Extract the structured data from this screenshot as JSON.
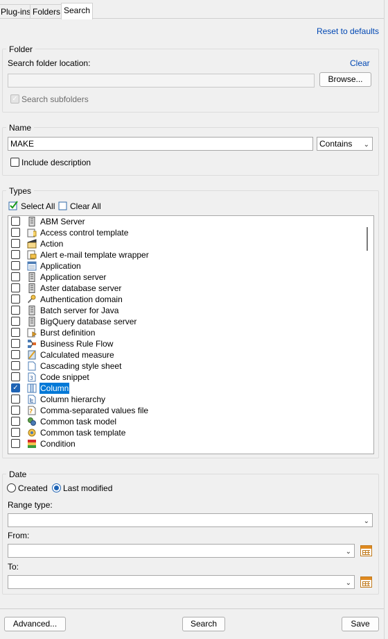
{
  "tabs": [
    {
      "label": "Plug-ins"
    },
    {
      "label": "Folders"
    },
    {
      "label": "Search",
      "active": true
    }
  ],
  "reset_link": "Reset to defaults",
  "folder": {
    "legend": "Folder",
    "location_label": "Search folder location:",
    "clear_link": "Clear",
    "location_value": "",
    "browse_button": "Browse...",
    "subfolders_label": "Search subfolders",
    "subfolders_checked": true,
    "subfolders_enabled": false
  },
  "name": {
    "legend": "Name",
    "value": "MAKE",
    "match_mode": "Contains",
    "include_description_label": "Include description",
    "include_description_checked": false
  },
  "types": {
    "legend": "Types",
    "select_all": "Select All",
    "clear_all": "Clear All",
    "items": [
      {
        "label": "ABM Server",
        "icon": "server-icon",
        "checked": false
      },
      {
        "label": "Access control template",
        "icon": "access-template-icon",
        "checked": false
      },
      {
        "label": "Action",
        "icon": "action-icon",
        "checked": false
      },
      {
        "label": "Alert e-mail template wrapper",
        "icon": "email-template-icon",
        "checked": false
      },
      {
        "label": "Application",
        "icon": "application-icon",
        "checked": false
      },
      {
        "label": "Application server",
        "icon": "server-icon",
        "checked": false
      },
      {
        "label": "Aster database server",
        "icon": "server-icon",
        "checked": false
      },
      {
        "label": "Authentication domain",
        "icon": "key-icon",
        "checked": false
      },
      {
        "label": "Batch server for Java",
        "icon": "server-icon",
        "checked": false
      },
      {
        "label": "BigQuery database server",
        "icon": "server-icon",
        "checked": false
      },
      {
        "label": "Burst definition",
        "icon": "burst-icon",
        "checked": false
      },
      {
        "label": "Business Rule Flow",
        "icon": "rule-flow-icon",
        "checked": false
      },
      {
        "label": "Calculated measure",
        "icon": "calculator-icon",
        "checked": false
      },
      {
        "label": "Cascading style sheet",
        "icon": "document-icon",
        "checked": false
      },
      {
        "label": "Code snippet",
        "icon": "code-icon",
        "checked": false
      },
      {
        "label": "Column",
        "icon": "column-icon",
        "checked": true,
        "selected": true
      },
      {
        "label": "Column hierarchy",
        "icon": "hierarchy-icon",
        "checked": false
      },
      {
        "label": "Comma-separated values file",
        "icon": "csv-file-icon",
        "checked": false
      },
      {
        "label": "Common task model",
        "icon": "task-model-icon",
        "checked": false
      },
      {
        "label": "Common task template",
        "icon": "task-template-icon",
        "checked": false
      },
      {
        "label": "Condition",
        "icon": "condition-icon",
        "checked": false
      }
    ]
  },
  "date": {
    "legend": "Date",
    "created_label": "Created",
    "last_modified_label": "Last modified",
    "selected": "Last modified",
    "range_type_label": "Range type:",
    "range_type_value": "",
    "from_label": "From:",
    "from_value": "",
    "to_label": "To:",
    "to_value": ""
  },
  "buttons": {
    "advanced": "Advanced...",
    "search": "Search",
    "save": "Save"
  },
  "colors": {
    "accent": "#0078d7",
    "link": "#0047b3",
    "check": "#1e63b4"
  }
}
